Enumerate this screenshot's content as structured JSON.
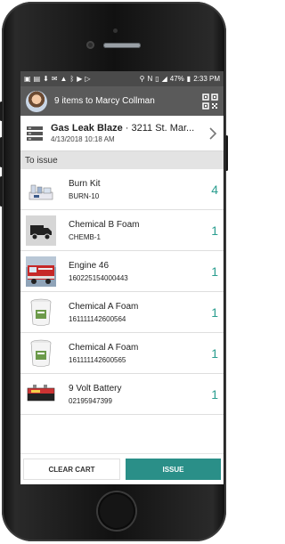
{
  "status_bar": {
    "battery": "47%",
    "time": "2:33 PM"
  },
  "app_bar": {
    "title": "9 items to Marcy Collman",
    "qr_icon": "qr-code-icon"
  },
  "incident": {
    "title": "Gas Leak Blaze",
    "location": "· 3211 St. Mar...",
    "datetime": "4/13/2018 10:18 AM"
  },
  "section_title": "To issue",
  "items": [
    {
      "name": "Burn Kit",
      "code": "BURN-10",
      "qty": "4",
      "icon": "kit-image"
    },
    {
      "name": "Chemical B Foam",
      "code": "CHEMB-1",
      "qty": "1",
      "icon": "truck-icon"
    },
    {
      "name": "Engine 46",
      "code": "160225154000443",
      "qty": "1",
      "icon": "fire-engine-image"
    },
    {
      "name": "Chemical A Foam",
      "code": "161111142600564",
      "qty": "1",
      "icon": "bucket-image"
    },
    {
      "name": "Chemical A Foam",
      "code": "161111142600565",
      "qty": "1",
      "icon": "bucket-image"
    },
    {
      "name": "9 Volt Battery",
      "code": "02195947399",
      "qty": "1",
      "icon": "battery-image"
    }
  ],
  "buttons": {
    "clear": "CLEAR CART",
    "issue": "ISSUE"
  },
  "colors": {
    "accent": "#2a8f88",
    "app_bar": "#5a5a5a",
    "status_bar": "#4a4a4a"
  }
}
